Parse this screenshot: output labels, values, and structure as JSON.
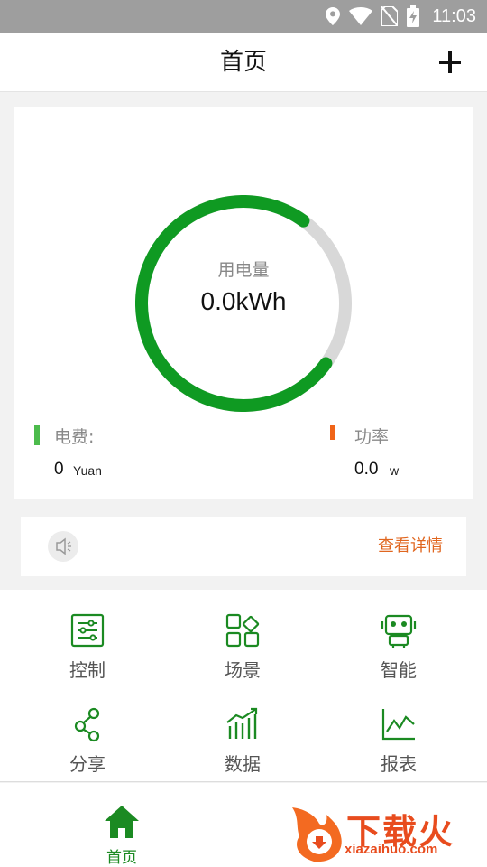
{
  "status_bar": {
    "time": "11:03",
    "icons": [
      "location-icon",
      "wifi-icon",
      "no-sim-icon",
      "battery-charging-icon"
    ]
  },
  "header": {
    "title": "首页",
    "add_icon": "plus-icon"
  },
  "usage": {
    "label": "用电量",
    "value": "0.0kWh",
    "gauge_fraction": 0.75,
    "gauge_color": "#0f9a22",
    "gauge_track_color": "#d8d8d8"
  },
  "stats": {
    "cost": {
      "label": "电费:",
      "value": "0",
      "unit": "Yuan",
      "color": "#4cbb4c"
    },
    "power": {
      "label": "功率",
      "value": "0.0",
      "unit": "w",
      "color": "#f06418"
    }
  },
  "notice": {
    "icon": "speaker-icon",
    "link_label": "查看详情",
    "link_color": "#e0661f"
  },
  "grid": [
    {
      "label": "控制",
      "icon": "sliders-icon"
    },
    {
      "label": "场景",
      "icon": "scene-grid-icon"
    },
    {
      "label": "智能",
      "icon": "robot-icon"
    },
    {
      "label": "分享",
      "icon": "share-icon"
    },
    {
      "label": "数据",
      "icon": "bar-trend-icon"
    },
    {
      "label": "报表",
      "icon": "line-chart-icon"
    }
  ],
  "bottom_nav": {
    "home_label": "首页",
    "home_icon": "home-icon",
    "accent": "#1b8a22"
  },
  "watermark": {
    "title": "下载火",
    "url": "xiazaihuo.com"
  }
}
